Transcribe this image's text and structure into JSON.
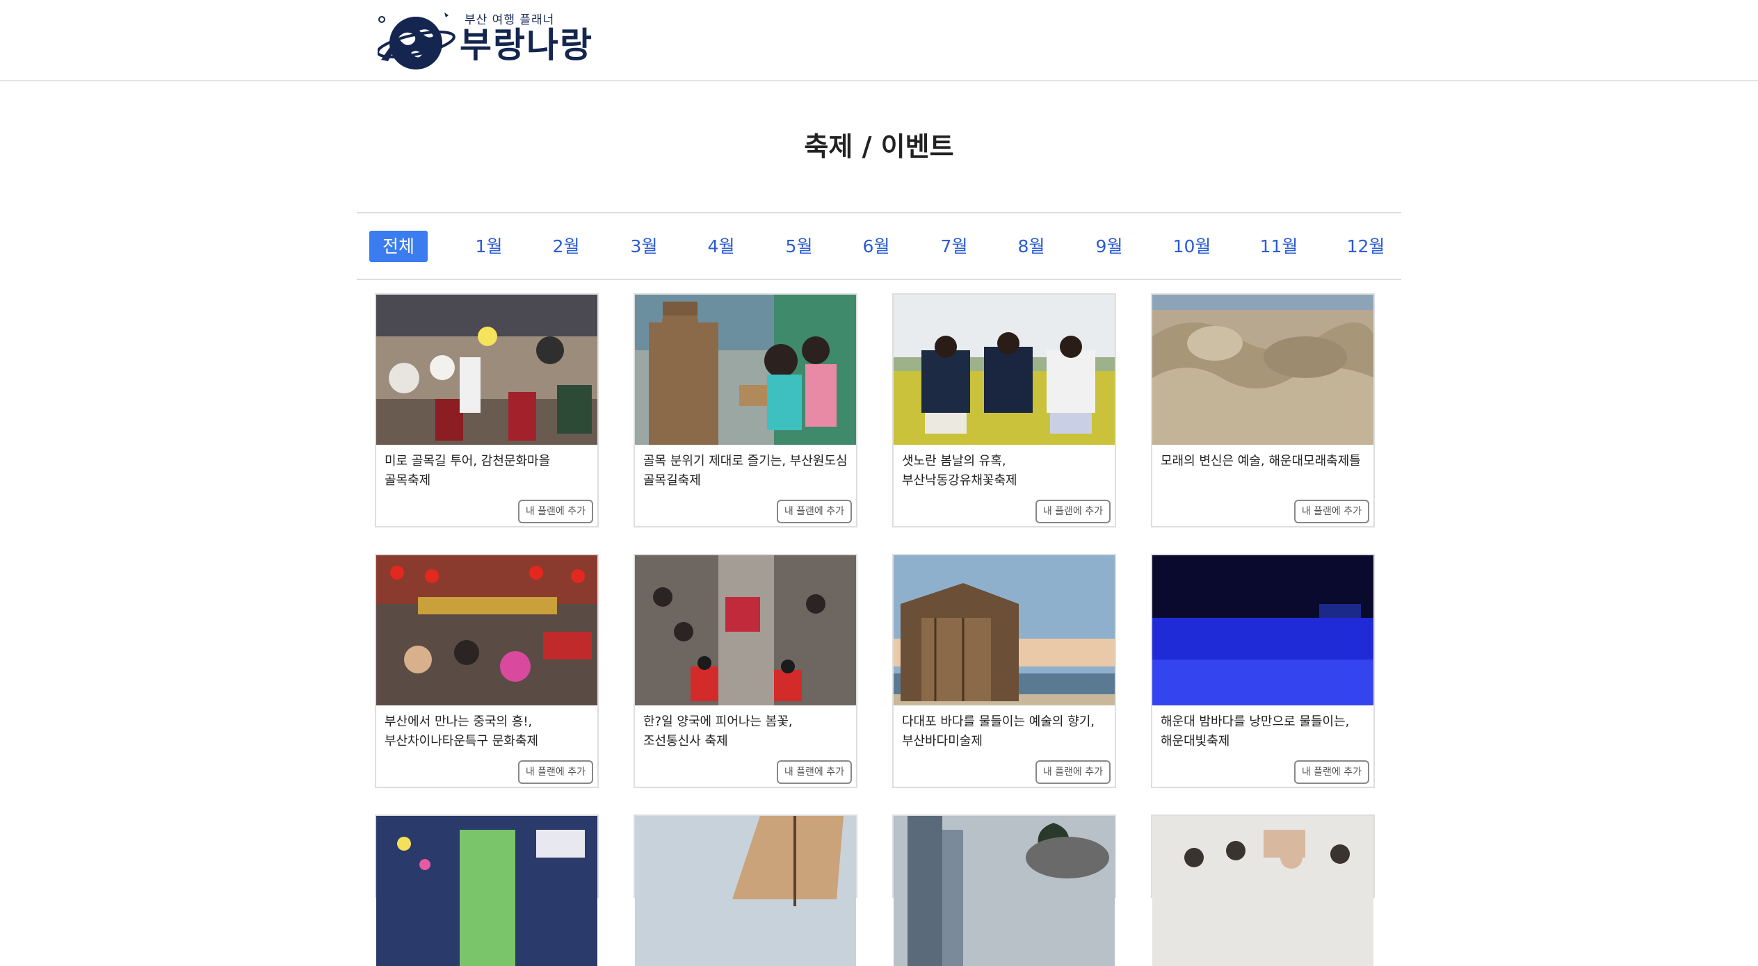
{
  "logo": {
    "subtitle": "부산 여행 플래너",
    "name": "부랑나랑"
  },
  "page_title": "축제 / 이벤트",
  "months": [
    "전체",
    "1월",
    "2월",
    "3월",
    "4월",
    "5월",
    "6월",
    "7월",
    "8월",
    "9월",
    "10월",
    "11월",
    "12월"
  ],
  "active_month": "전체",
  "add_label": "내 플랜에 추가",
  "cards": [
    {
      "title": "미로 골목길 투어, 감천문화마을 골목축제",
      "photo": "festival-parade-photo"
    },
    {
      "title": "골목 분위기 제대로 즐기는, 부산원도심 골목길축제",
      "photo": "street-statue-photo"
    },
    {
      "title": "샛노란 봄날의 유혹, 부산낙동강유채꽃축제",
      "photo": "canola-flower-photo"
    },
    {
      "title": "모래의 변신은 예술, 해운대모래축제틀",
      "photo": "sand-sculpture-photo"
    },
    {
      "title": "부산에서 만나는 중국의 흥!, 부산차이나타운특구 문화축제",
      "photo": "chinatown-crowd-photo"
    },
    {
      "title": "한?일 양국에 피어나는 봄꽃, 조선통신사 축제",
      "photo": "procession-photo"
    },
    {
      "title": "다대포 바다를 물들이는 예술의 향기, 부산바다미술제",
      "photo": "sea-art-hut-photo"
    },
    {
      "title": "해운대 밤바다를 낭만으로 물들이는, 해운대빛축제",
      "photo": "night-light-photo"
    },
    {
      "title": "",
      "photo": "light-street-photo"
    },
    {
      "title": "",
      "photo": "sailboat-photo"
    },
    {
      "title": "",
      "photo": "bonfire-photo"
    },
    {
      "title": "",
      "photo": "beach-crowd-photo"
    }
  ]
}
